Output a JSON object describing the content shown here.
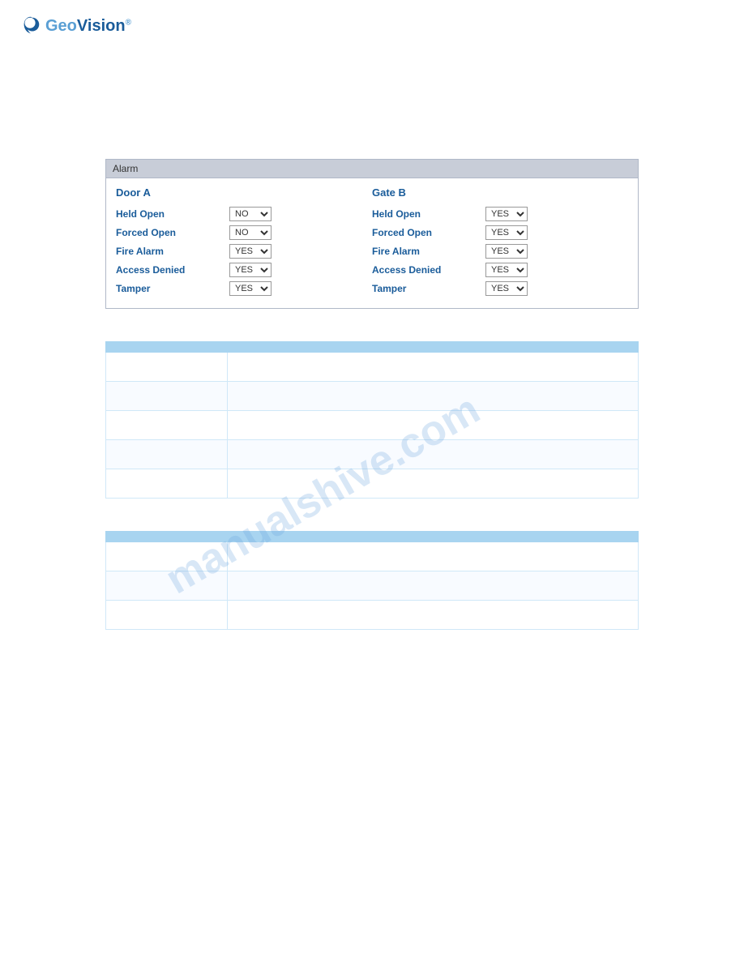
{
  "header": {
    "logo_alt": "GeoVision logo",
    "logo_letter": "G"
  },
  "alarm_panel": {
    "title": "Alarm",
    "door_a": {
      "section_title": "Door A",
      "rows": [
        {
          "label": "Held Open",
          "value": "NO"
        },
        {
          "label": "Forced Open",
          "value": "NO"
        },
        {
          "label": "Fire Alarm",
          "value": "YES"
        },
        {
          "label": "Access Denied",
          "value": "YES"
        },
        {
          "label": "Tamper",
          "value": "YES"
        }
      ]
    },
    "gate_b": {
      "section_title": "Gate B",
      "rows": [
        {
          "label": "Held Open",
          "value": "YES"
        },
        {
          "label": "Forced Open",
          "value": "YES"
        },
        {
          "label": "Fire Alarm",
          "value": "YES"
        },
        {
          "label": "Access Denied",
          "value": "YES"
        },
        {
          "label": "Tamper",
          "value": "YES"
        }
      ]
    }
  },
  "table1": {
    "headers": [
      "",
      ""
    ],
    "rows": [
      [
        "",
        ""
      ],
      [
        "",
        ""
      ],
      [
        "",
        ""
      ],
      [
        "",
        ""
      ],
      [
        "",
        ""
      ]
    ]
  },
  "table2": {
    "headers": [
      "",
      ""
    ],
    "rows": [
      [
        "",
        ""
      ],
      [
        "",
        ""
      ],
      [
        "",
        ""
      ]
    ]
  },
  "watermark": "manualshive.com"
}
